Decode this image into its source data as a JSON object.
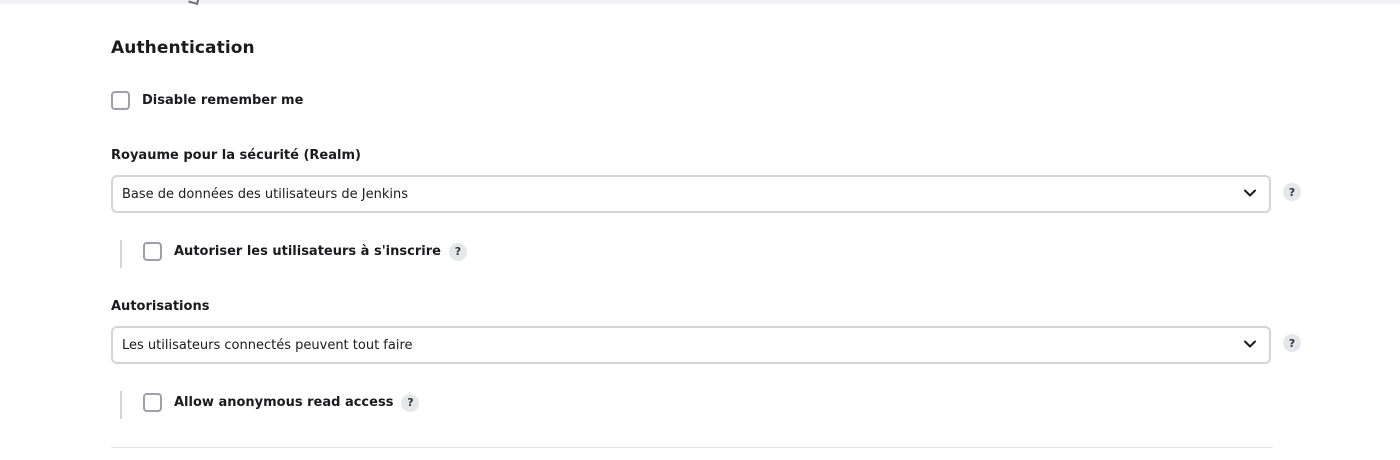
{
  "authentication": {
    "title": "Authentication",
    "disable_remember_me": {
      "label": "Disable remember me",
      "checked": false
    }
  },
  "security_realm": {
    "label": "Royaume pour la sécurité (Realm)",
    "selected": "Base de données des utilisateurs de Jenkins",
    "help": "?",
    "allow_signup": {
      "label": "Autoriser les utilisateurs à s'inscrire",
      "checked": false,
      "help": "?"
    }
  },
  "authorization": {
    "label": "Autorisations",
    "selected": "Les utilisateurs connectés peuvent tout faire",
    "help": "?",
    "anonymous_read": {
      "label": "Allow anonymous read access",
      "checked": false,
      "help": "?"
    }
  },
  "icons": {
    "dropdown": "chevron-down-icon",
    "help": "help-icon"
  }
}
